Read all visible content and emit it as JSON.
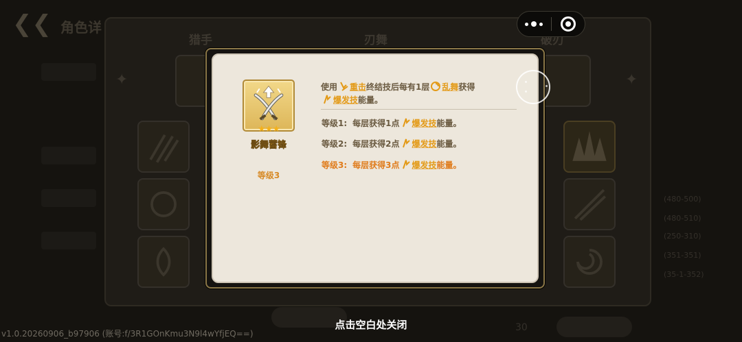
{
  "background": {
    "title": "角色详",
    "tabs": [
      "猎手",
      "刃舞",
      "破刃"
    ],
    "right_rows": [
      "(480-500)",
      "(480-510)",
      "(250-310)",
      "(351-351)",
      "(35-1-352)"
    ],
    "bottom_count": "30"
  },
  "capsule": {
    "menu_icon": "more-dots-icon",
    "close_icon": "target-close-icon"
  },
  "modal": {
    "skill": {
      "icon": "crossed-swords-icon",
      "stars": "★★★",
      "name": "影舞蓄锋",
      "level": "等级3"
    },
    "description": {
      "prefix": "使用",
      "term1": "重击",
      "mid1": "终结技后每有1层",
      "term2": "乱舞",
      "mid2": "获得",
      "term3": "爆发技",
      "suffix": "能量。"
    },
    "levels": [
      {
        "label": "等级1:",
        "text": "每层获得1点",
        "term": "爆发技",
        "suffix": "能量。",
        "current": false
      },
      {
        "label": "等级2:",
        "text": "每层获得2点",
        "term": "爆发技",
        "suffix": "能量。",
        "current": false
      },
      {
        "label": "等级3:",
        "text": "每层获得3点",
        "term": "爆发技",
        "suffix": "能量。",
        "current": true
      }
    ]
  },
  "close_hint": "点击空白处关闭",
  "version": "v1.0.20260906_b97906 (账号:f/3R1GOnKmu3N9l4wYfjEQ==)",
  "colors": {
    "highlight": "#e39a17",
    "current_level": "#e07c1c",
    "body_text": "#6a5a40",
    "frame_gold": "#8b7747"
  }
}
